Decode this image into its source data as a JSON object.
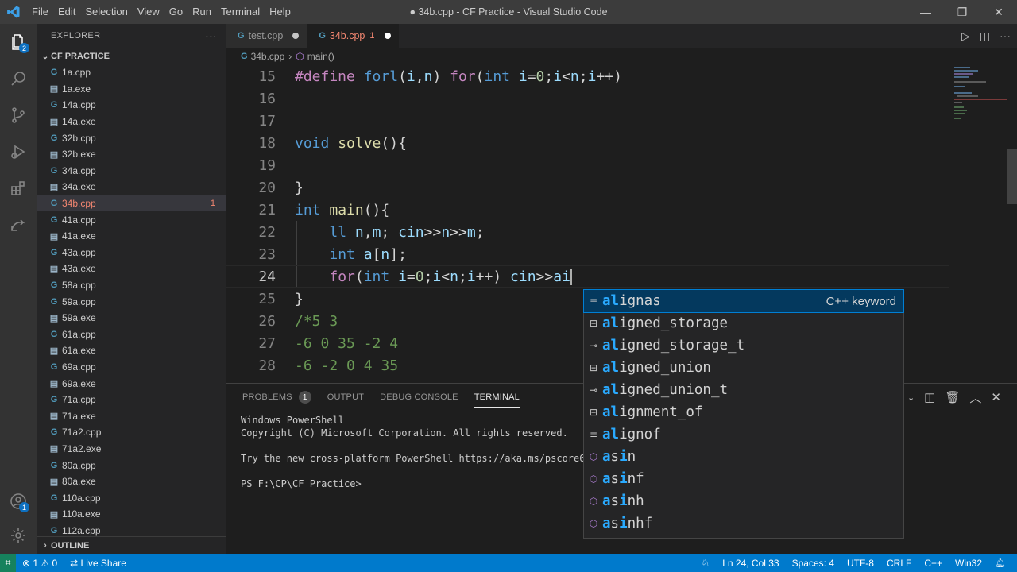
{
  "titlebar": {
    "logo": "⫸",
    "menu": [
      "File",
      "Edit",
      "Selection",
      "View",
      "Go",
      "Run",
      "Terminal",
      "Help"
    ],
    "title": "● 34b.cpp - CF Practice - Visual Studio Code",
    "controls": [
      "—",
      "❐",
      "✕"
    ]
  },
  "activity": {
    "explorer_badge": "2",
    "accounts_badge": "1"
  },
  "sidebar": {
    "header": "EXPLORER",
    "more": "···",
    "folder": "CF PRACTICE",
    "files": [
      {
        "name": "1a.cpp",
        "type": "cpp"
      },
      {
        "name": "1a.exe",
        "type": "exe"
      },
      {
        "name": "14a.cpp",
        "type": "cpp"
      },
      {
        "name": "14a.exe",
        "type": "exe"
      },
      {
        "name": "32b.cpp",
        "type": "cpp"
      },
      {
        "name": "32b.exe",
        "type": "exe"
      },
      {
        "name": "34a.cpp",
        "type": "cpp"
      },
      {
        "name": "34a.exe",
        "type": "exe"
      },
      {
        "name": "34b.cpp",
        "type": "cpp",
        "active": true,
        "problems": "1"
      },
      {
        "name": "41a.cpp",
        "type": "cpp"
      },
      {
        "name": "41a.exe",
        "type": "exe"
      },
      {
        "name": "43a.cpp",
        "type": "cpp"
      },
      {
        "name": "43a.exe",
        "type": "exe"
      },
      {
        "name": "58a.cpp",
        "type": "cpp"
      },
      {
        "name": "59a.cpp",
        "type": "cpp"
      },
      {
        "name": "59a.exe",
        "type": "exe"
      },
      {
        "name": "61a.cpp",
        "type": "cpp"
      },
      {
        "name": "61a.exe",
        "type": "exe"
      },
      {
        "name": "69a.cpp",
        "type": "cpp"
      },
      {
        "name": "69a.exe",
        "type": "exe"
      },
      {
        "name": "71a.cpp",
        "type": "cpp"
      },
      {
        "name": "71a.exe",
        "type": "exe"
      },
      {
        "name": "71a2.cpp",
        "type": "cpp"
      },
      {
        "name": "71a2.exe",
        "type": "exe"
      },
      {
        "name": "80a.cpp",
        "type": "cpp"
      },
      {
        "name": "80a.exe",
        "type": "exe"
      },
      {
        "name": "110a.cpp",
        "type": "cpp"
      },
      {
        "name": "110a.exe",
        "type": "exe"
      },
      {
        "name": "112a.cpp",
        "type": "cpp"
      }
    ],
    "outline": "OUTLINE"
  },
  "tabs": {
    "items": [
      {
        "label": "test.cpp",
        "icon": "G"
      },
      {
        "label": "34b.cpp",
        "icon": "G",
        "problems": "1"
      }
    ]
  },
  "breadcrumb": {
    "file": "34b.cpp",
    "symbol": "main()"
  },
  "editor": {
    "lines": [
      {
        "n": "15",
        "html": "<span class='pp'>#define</span> <span class='mac'>forl</span>(<span class='var'>i</span>,<span class='var'>n</span>) <span class='ctl'>for</span>(<span class='kw'>int</span> <span class='var'>i</span>=<span class='num'>0</span>;<span class='var'>i</span>&lt;<span class='var'>n</span>;<span class='var'>i</span>++)"
      },
      {
        "n": "16",
        "html": ""
      },
      {
        "n": "17",
        "html": ""
      },
      {
        "n": "18",
        "html": "<span class='kw'>void</span> <span class='fn'>solve</span>(){"
      },
      {
        "n": "19",
        "html": ""
      },
      {
        "n": "20",
        "html": "}"
      },
      {
        "n": "21",
        "html": "<span class='kw'>int</span> <span class='fn'>main</span>(){"
      },
      {
        "n": "22",
        "html": "    <span class='kw'>ll</span> <span class='var'>n</span>,<span class='var'>m</span>; <span class='var'>cin</span>&gt;&gt;<span class='var'>n</span>&gt;&gt;<span class='var'>m</span>;"
      },
      {
        "n": "23",
        "html": "    <span class='kw'>int</span> <span class='var'>a</span>[<span class='var'>n</span>];"
      },
      {
        "n": "24",
        "html": "    <span class='ctl'>for</span>(<span class='kw'>int</span> <span class='var'>i</span>=<span class='num'>0</span>;<span class='var'>i</span>&lt;<span class='var'>n</span>;<span class='var'>i</span>++) <span class='var'>cin</span>&gt;&gt;<span class='var'>ai</span>",
        "current": true
      },
      {
        "n": "25",
        "html": "}"
      },
      {
        "n": "26",
        "html": "<span class='cmt'>/*5 3</span>"
      },
      {
        "n": "27",
        "html": "<span class='cmt'>-6 0 35 -2 4</span>"
      },
      {
        "n": "28",
        "html": "<span class='cmt'>-6 -2 0 4 35</span>"
      }
    ]
  },
  "suggest": {
    "items": [
      {
        "match": "al",
        "rest": "ignas",
        "icon": "≡",
        "detail": "C++ keyword",
        "selected": true
      },
      {
        "match": "al",
        "rest": "igned_storage",
        "icon": "⊟"
      },
      {
        "match": "al",
        "rest": "igned_storage_t",
        "icon": "⊸"
      },
      {
        "match": "al",
        "rest": "igned_union",
        "icon": "⊟"
      },
      {
        "match": "al",
        "rest": "igned_union_t",
        "icon": "⊸"
      },
      {
        "match": "al",
        "rest": "ignment_of",
        "icon": "⊟"
      },
      {
        "match": "al",
        "rest": "ignof",
        "icon": "≡"
      },
      {
        "match": "as",
        "rest": "in",
        "icon": "⬡",
        "cube": true,
        "pre": "",
        "split": true
      },
      {
        "match": "as",
        "rest": "inf",
        "icon": "⬡",
        "cube": true
      },
      {
        "match": "as",
        "rest": "inh",
        "icon": "⬡",
        "cube": true
      },
      {
        "match": "as",
        "rest": "inhf",
        "icon": "⬡",
        "cube": true
      }
    ]
  },
  "panel": {
    "tabs": [
      {
        "label": "PROBLEMS",
        "count": "1"
      },
      {
        "label": "OUTPUT"
      },
      {
        "label": "DEBUG CONSOLE"
      },
      {
        "label": "TERMINAL",
        "active": true
      }
    ],
    "terminal": "Windows PowerShell\nCopyright (C) Microsoft Corporation. All rights reserved.\n\nTry the new cross-platform PowerShell https://aka.ms/pscore6\n\nPS F:\\CP\\CF Practice>"
  },
  "status": {
    "left": [
      "⊗ 1 ⚠ 0",
      "⇄ Live Share"
    ],
    "right": [
      "Ln 24, Col 33",
      "Spaces: 4",
      "UTF-8",
      "CRLF",
      "C++",
      "Win32"
    ]
  }
}
